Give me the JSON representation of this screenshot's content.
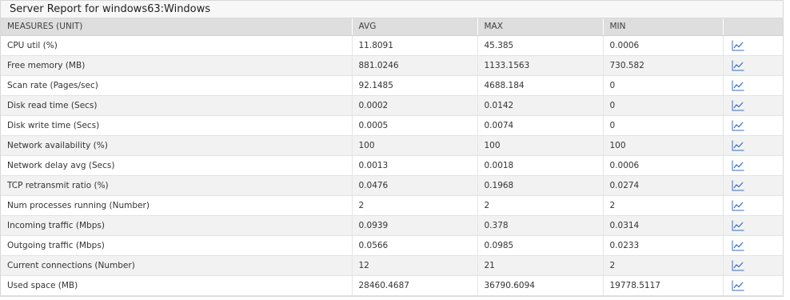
{
  "title": "Server Report for windows63:Windows",
  "columns": [
    "MEASURES (UNIT)",
    "AVG",
    "MAX",
    "MIN",
    ""
  ],
  "graph_icon": "line-graph-icon",
  "colors": {
    "header_bg": "#dedede",
    "stripe": "#f2f2f2",
    "icon": "#3a6fbd"
  },
  "rows": [
    {
      "measure": "CPU util (%)",
      "avg": "11.8091",
      "max": "45.385",
      "min": "0.0006"
    },
    {
      "measure": "Free memory (MB)",
      "avg": "881.0246",
      "max": "1133.1563",
      "min": "730.582"
    },
    {
      "measure": "Scan rate (Pages/sec)",
      "avg": "92.1485",
      "max": "4688.184",
      "min": "0"
    },
    {
      "measure": "Disk read time (Secs)",
      "avg": "0.0002",
      "max": "0.0142",
      "min": "0"
    },
    {
      "measure": "Disk write time (Secs)",
      "avg": "0.0005",
      "max": "0.0074",
      "min": "0"
    },
    {
      "measure": "Network availability (%)",
      "avg": "100",
      "max": "100",
      "min": "100"
    },
    {
      "measure": "Network delay avg (Secs)",
      "avg": "0.0013",
      "max": "0.0018",
      "min": "0.0006"
    },
    {
      "measure": "TCP retransmit ratio (%)",
      "avg": "0.0476",
      "max": "0.1968",
      "min": "0.0274"
    },
    {
      "measure": "Num processes running (Number)",
      "avg": "2",
      "max": "2",
      "min": "2"
    },
    {
      "measure": "Incoming traffic (Mbps)",
      "avg": "0.0939",
      "max": "0.378",
      "min": "0.0314"
    },
    {
      "measure": "Outgoing traffic (Mbps)",
      "avg": "0.0566",
      "max": "0.0985",
      "min": "0.0233"
    },
    {
      "measure": "Current connections (Number)",
      "avg": "12",
      "max": "21",
      "min": "2"
    },
    {
      "measure": "Used space (MB)",
      "avg": "28460.4687",
      "max": "36790.6094",
      "min": "19778.5117"
    }
  ]
}
